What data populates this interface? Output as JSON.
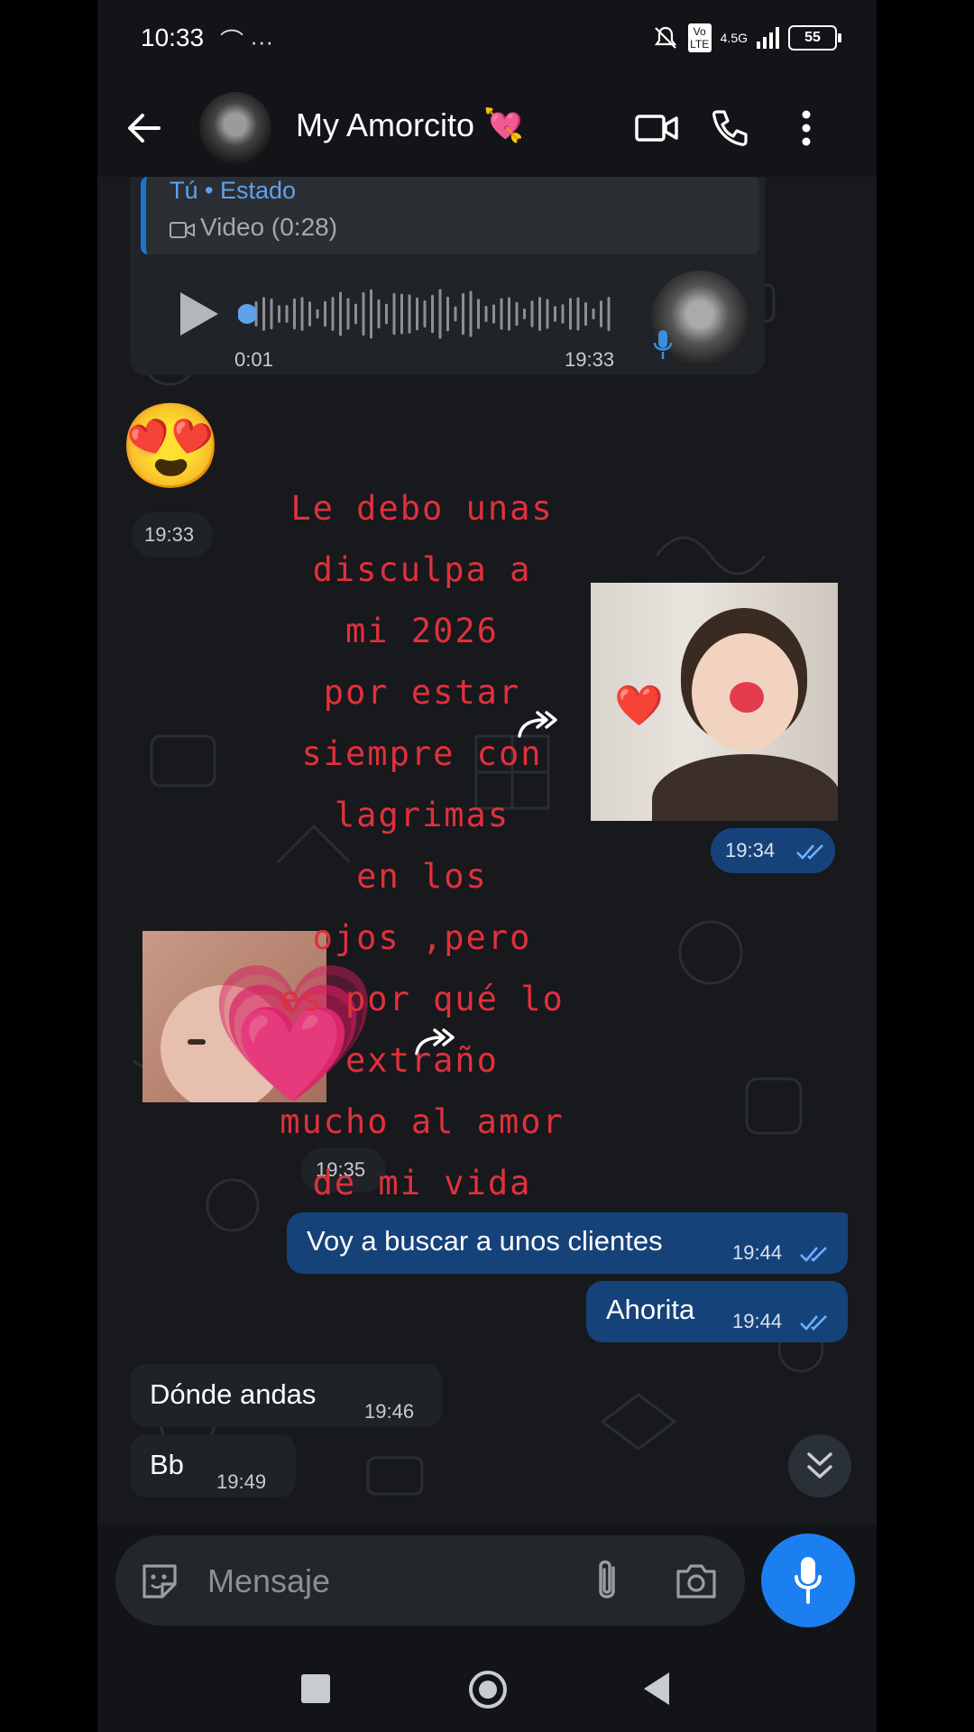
{
  "status_bar": {
    "time": "10:33",
    "left_icons": "⌒ ···",
    "network": "4.5G",
    "volte": "Vo LTE",
    "battery": "55"
  },
  "header": {
    "contact_name": "My Amorcito 💘"
  },
  "voice_message": {
    "quote_title": "Tú • Estado",
    "quote_body": "Video (0:28)",
    "duration": "0:01",
    "time": "19:33"
  },
  "messages": [
    {
      "type": "emoji",
      "text": "😍",
      "time": "19:33"
    },
    {
      "type": "image",
      "time": "19:34"
    },
    {
      "type": "image",
      "time": "19:35"
    },
    {
      "type": "text",
      "text": "Voy a buscar a unos clientes",
      "time": "19:44"
    },
    {
      "type": "text",
      "text": "Ahorita",
      "time": "19:44"
    },
    {
      "type": "text",
      "text": "Dónde andas",
      "time": "19:46"
    },
    {
      "type": "text",
      "text": "Bb",
      "time": "19:49"
    }
  ],
  "overlay_lines": [
    "Le debo unas",
    "disculpa a",
    "mi 2026",
    "por estar",
    "siempre con",
    "lagrimas",
    "en los",
    "ojos ,pero",
    "es por qué lo",
    "extraño",
    "mucho al amor",
    "de mi vida"
  ],
  "stickers": {
    "heart_small": "❤️",
    "heart_large": "💗"
  },
  "input": {
    "placeholder": "Mensaje"
  },
  "colors": {
    "outgoing": "#16427a",
    "incoming": "#1f2226",
    "accent": "#1b7ff0",
    "overlay_text": "#e0303d"
  }
}
